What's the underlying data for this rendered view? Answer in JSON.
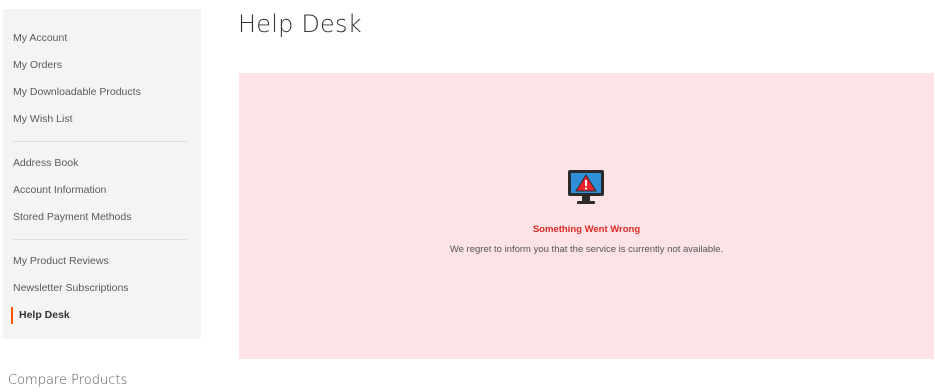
{
  "sidebar": {
    "groups": [
      [
        {
          "label": "My Account"
        },
        {
          "label": "My Orders"
        },
        {
          "label": "My Downloadable Products"
        },
        {
          "label": "My Wish List"
        }
      ],
      [
        {
          "label": "Address Book"
        },
        {
          "label": "Account Information"
        },
        {
          "label": "Stored Payment Methods"
        }
      ],
      [
        {
          "label": "My Product Reviews"
        },
        {
          "label": "Newsletter Subscriptions"
        },
        {
          "label": "Help Desk"
        }
      ]
    ],
    "active_item": "Help Desk",
    "active_color": "#ff5501"
  },
  "main": {
    "title": "Help Desk",
    "error": {
      "title": "Something Went Wrong",
      "message": "We regret to inform you that the service is currently not available.",
      "icon": "monitor-warning-icon",
      "background_color": "#fde3e5",
      "title_color": "#e02b27"
    }
  },
  "compare": {
    "title": "Compare Products"
  }
}
